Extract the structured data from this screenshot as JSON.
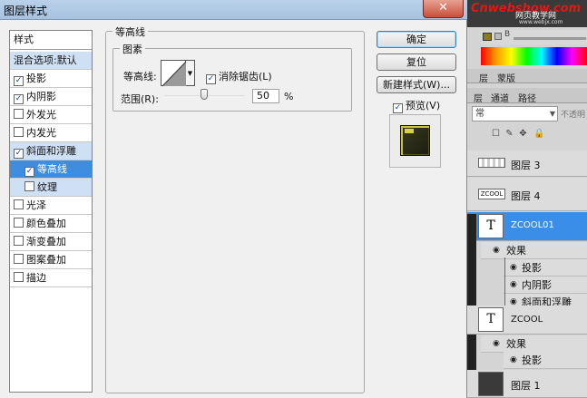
{
  "dialog": {
    "title": "图层样式",
    "close_symbol": "✕"
  },
  "style_list": {
    "header": "样式",
    "items": [
      {
        "label": "混合选项:默认",
        "checkbox": false,
        "checked": false
      },
      {
        "label": "投影",
        "checkbox": true,
        "checked": true
      },
      {
        "label": "内阴影",
        "checkbox": true,
        "checked": true
      },
      {
        "label": "外发光",
        "checkbox": true,
        "checked": false
      },
      {
        "label": "内发光",
        "checkbox": true,
        "checked": false
      },
      {
        "label": "斜面和浮雕",
        "checkbox": true,
        "checked": true
      },
      {
        "label": "等高线",
        "checkbox": true,
        "checked": true
      },
      {
        "label": "纹理",
        "checkbox": true,
        "checked": false
      },
      {
        "label": "光泽",
        "checkbox": true,
        "checked": false
      },
      {
        "label": "颜色叠加",
        "checkbox": true,
        "checked": false
      },
      {
        "label": "渐变叠加",
        "checkbox": true,
        "checked": false
      },
      {
        "label": "图案叠加",
        "checkbox": true,
        "checked": false
      },
      {
        "label": "描边",
        "checkbox": true,
        "checked": false
      }
    ],
    "check_mark": "✓"
  },
  "contour_panel": {
    "section_title": "等高线",
    "elements_title": "图素",
    "contour_label": "等高线:",
    "antialias_label": "消除锯齿(L)",
    "antialias_checked": true,
    "range_label": "范围(R):",
    "range_value": "50",
    "range_fraction": 0.5,
    "range_unit": "%"
  },
  "buttons": {
    "ok": "确定",
    "reset": "复位",
    "new_style": "新建样式(W)...",
    "preview_label": "预览(V)",
    "preview_checked": true
  },
  "photoshop_panel": {
    "watermark_site": "Cnwebshow.com",
    "watermark_name": "网页教学网",
    "watermark_url": "www.webjx.com",
    "color_letter": "B",
    "tabs_top": [
      "层",
      "蒙版"
    ],
    "tabs_layers": [
      "层",
      "通道",
      "路径"
    ],
    "blend_mode": "常",
    "opacity_label": "不透明",
    "layers": [
      {
        "name": "图层 3",
        "thumb": "checker"
      },
      {
        "name": "图层 4",
        "thumb": "ZCOOL"
      },
      {
        "name": "ZCOOL01",
        "thumb": "T",
        "selected": true
      },
      {
        "name": "效果",
        "fx": true
      },
      {
        "name": "投影",
        "fx": true
      },
      {
        "name": "内阴影",
        "fx": true
      },
      {
        "name": "斜面和浮雕",
        "fx": true
      },
      {
        "name": "ZCOOL",
        "thumb": "T"
      },
      {
        "name": "效果",
        "fx": true
      },
      {
        "name": "投影",
        "fx": true
      },
      {
        "name": "图层 1",
        "thumb": "dark"
      }
    ]
  },
  "colors": {
    "selection": "#3d8de0",
    "active_style": "#cfe0f4",
    "title_bar": "#b9d1ea",
    "watermark_red": "#e01818"
  }
}
